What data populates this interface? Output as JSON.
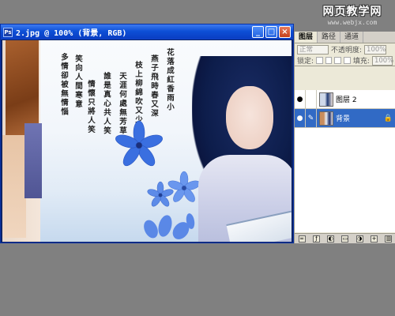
{
  "watermark": {
    "main": "网页教学网",
    "sub": "www.webjx.com"
  },
  "document": {
    "icon_label": "Ps",
    "title": "2.jpg @ 100% (背景, RGB)",
    "buttons": {
      "minimize": "_",
      "maximize": "□",
      "close": "×"
    },
    "poem_columns": [
      "花落成紅香雨小",
      "燕子飛時春又深",
      "枝上柳綿吹又少",
      "天涯何處無芳草",
      "誰是真心共人笑",
      "情懷只將人笑",
      "笑向人間寒意",
      "多情卻被無情惱"
    ]
  },
  "layers_panel": {
    "tabs": [
      "图层",
      "路径",
      "通道"
    ],
    "blend_mode": "正常",
    "opacity_label": "不透明度:",
    "opacity_value": "100%",
    "lock_label": "锁定:",
    "fill_label": "填充:",
    "fill_value": "100%",
    "layers": [
      {
        "name": "图层 2",
        "selected": false,
        "locked": false
      },
      {
        "name": "背景",
        "selected": true,
        "locked": true
      }
    ],
    "footer_icons": [
      "link-icon",
      "style-icon",
      "mask-icon",
      "set-icon",
      "adjustment-icon",
      "new-layer-icon",
      "trash-icon"
    ]
  },
  "colors": {
    "titlebar": "#0d4fd6",
    "selection": "#316ac5",
    "workspace": "#808080",
    "flower": "#3a6fe0"
  }
}
